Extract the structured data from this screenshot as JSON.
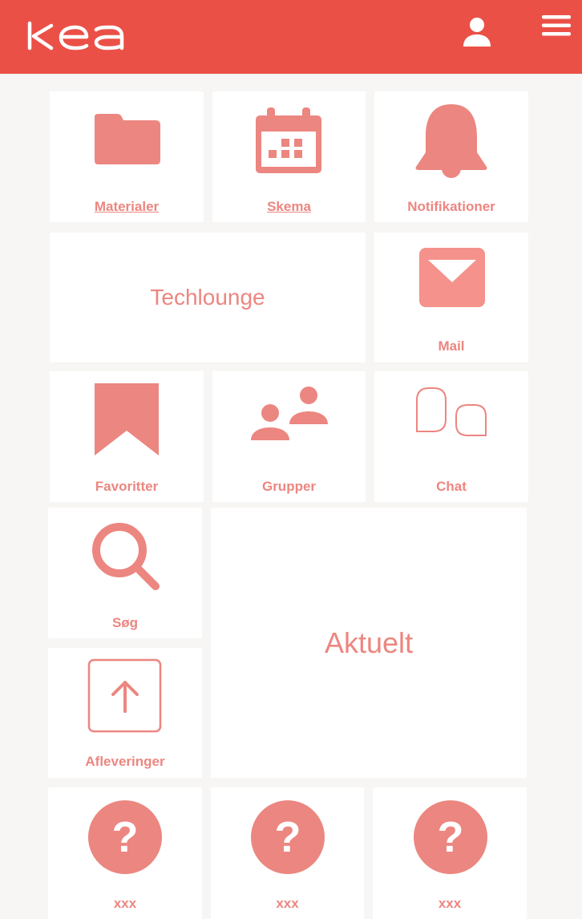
{
  "brand": {
    "logo_text": "kea",
    "header_color": "#eb5047",
    "accent_color": "#ec8680"
  },
  "header": {
    "user_icon": "user-icon",
    "menu_icon": "hamburger-menu-icon"
  },
  "tiles": {
    "materialer": {
      "label": "Materialer",
      "icon": "folder-icon"
    },
    "skema": {
      "label": "Skema",
      "icon": "calendar-icon"
    },
    "notifikationer": {
      "label": "Notifikationer",
      "icon": "bell-icon"
    },
    "techlounge": {
      "label": "Techlounge"
    },
    "mail": {
      "label": "Mail",
      "icon": "mail-icon"
    },
    "favoritter": {
      "label": "Favoritter",
      "icon": "bookmark-icon"
    },
    "grupper": {
      "label": "Grupper",
      "icon": "group-icon"
    },
    "chat": {
      "label": "Chat",
      "icon": "chat-bubbles-icon"
    },
    "soeg": {
      "label": "Søg",
      "icon": "search-icon"
    },
    "aktuelt": {
      "label": "Aktuelt"
    },
    "afleveringer": {
      "label": "Afleveringer",
      "icon": "upload-icon"
    },
    "xxx1": {
      "label": "xxx",
      "icon": "question-icon"
    },
    "xxx2": {
      "label": "xxx",
      "icon": "question-icon"
    },
    "xxx3": {
      "label": "xxx",
      "icon": "question-icon"
    }
  }
}
